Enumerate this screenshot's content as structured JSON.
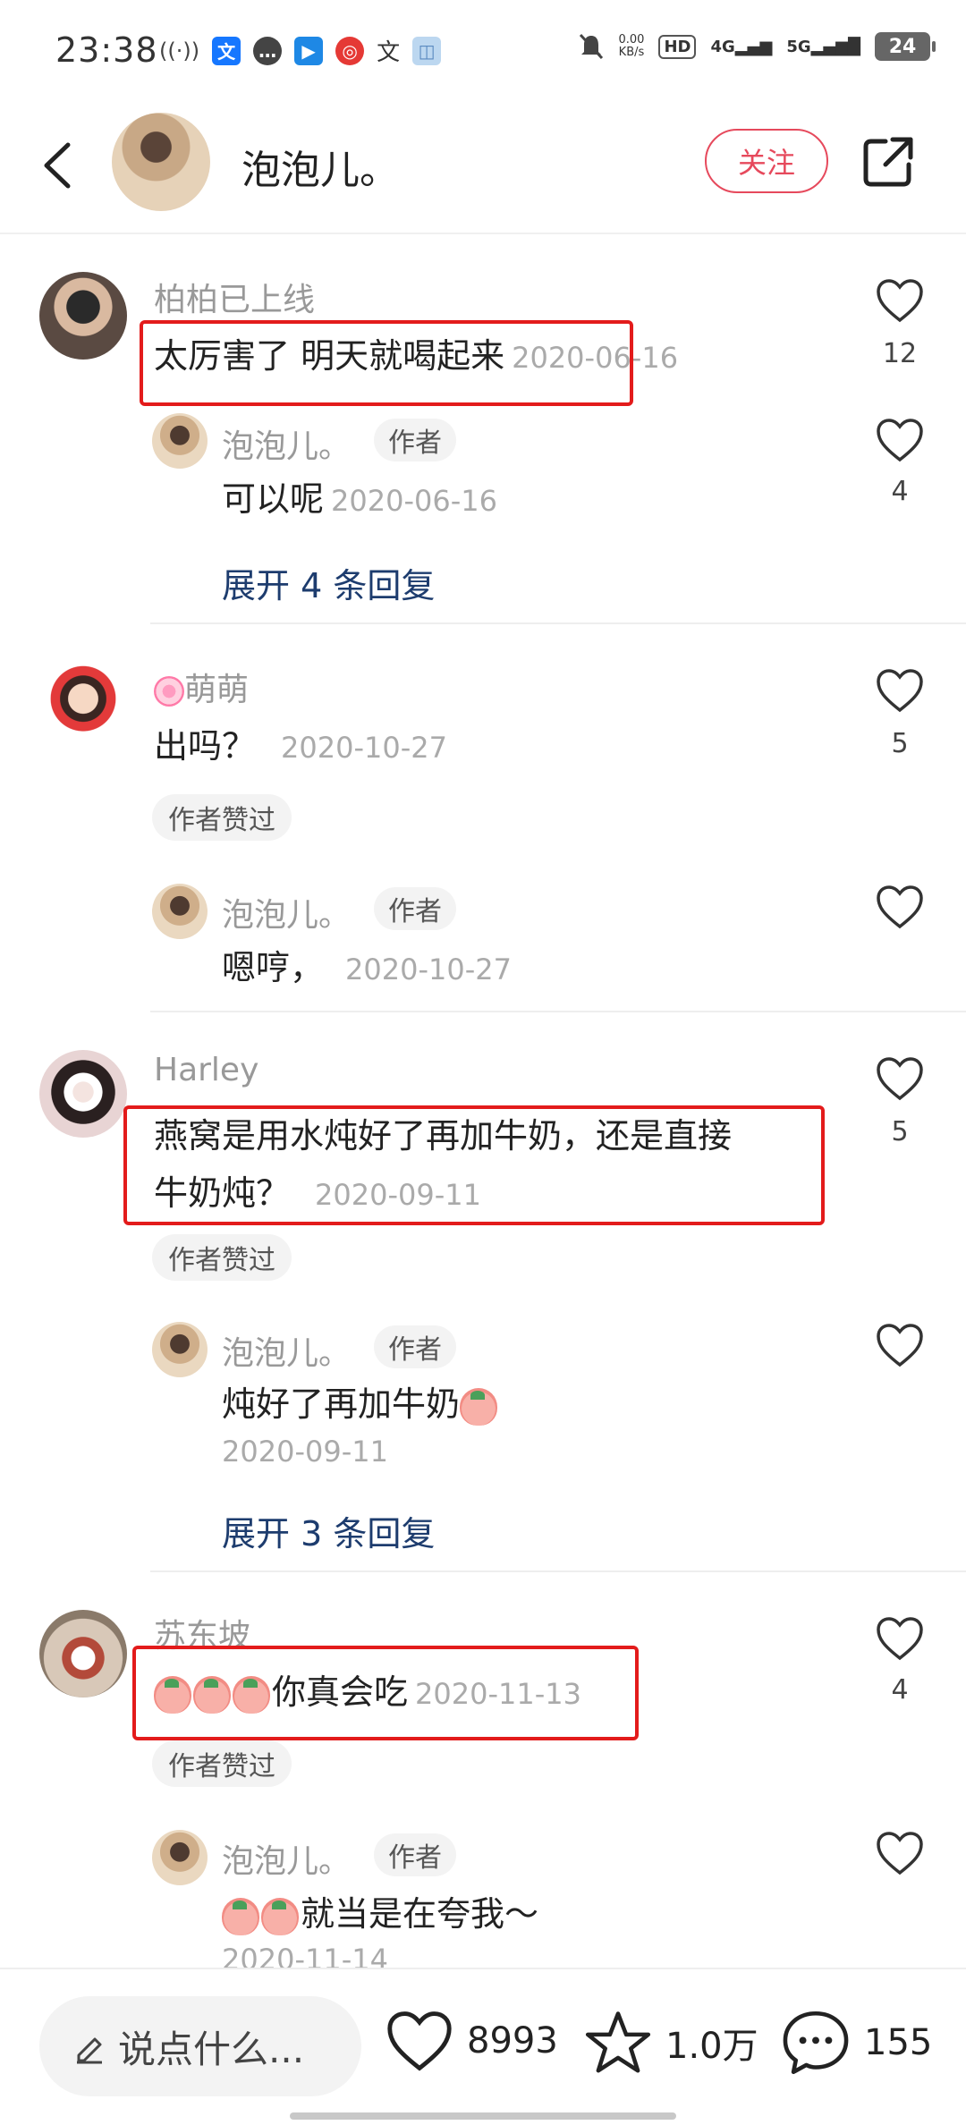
{
  "status_bar": {
    "time": "23:38",
    "net_speed_value": "0.00",
    "net_speed_unit": "KB/s",
    "hd_label": "HD",
    "signal1": "4G",
    "signal2": "5G",
    "battery": "24"
  },
  "header": {
    "user_name": "泡泡儿。",
    "follow_label": "关注"
  },
  "comments": [
    {
      "name": "柏柏已上线",
      "text": "太厉害了 明天就喝起来",
      "date": "2020-06-16",
      "likes": "12",
      "reply": {
        "name": "泡泡儿。",
        "tag": "作者",
        "text": "可以呢",
        "date": "2020-06-16",
        "likes": "4"
      },
      "expand_label": "展开 4 条回复"
    },
    {
      "name": "萌萌",
      "text": "出吗？",
      "date": "2020-10-27",
      "likes": "5",
      "liked_tag": "作者赞过",
      "reply": {
        "name": "泡泡儿。",
        "tag": "作者",
        "text": "嗯哼，",
        "date": "2020-10-27"
      }
    },
    {
      "name": "Harley",
      "text_line1": "燕窝是用水炖好了再加牛奶，还是直接",
      "text_line2": "牛奶炖？",
      "date": "2020-09-11",
      "likes": "5",
      "liked_tag": "作者赞过",
      "reply": {
        "name": "泡泡儿。",
        "tag": "作者",
        "text": "炖好了再加牛奶",
        "date": "2020-09-11"
      },
      "expand_label": "展开 3 条回复"
    },
    {
      "name": "苏东坡",
      "text": "你真会吃",
      "date": "2020-11-13",
      "likes": "4",
      "liked_tag": "作者赞过",
      "reply": {
        "name": "泡泡儿。",
        "tag": "作者",
        "text": "就当是在夸我～",
        "date": "2020-11-14"
      }
    }
  ],
  "bottom_bar": {
    "input_placeholder": "说点什么...",
    "like_count": "8993",
    "fav_count": "1.0万",
    "comment_count": "155"
  },
  "colors": {
    "accent_red": "#e6495c",
    "annotation_red": "#e31b1b",
    "expand_blue": "#1d3c6e"
  }
}
